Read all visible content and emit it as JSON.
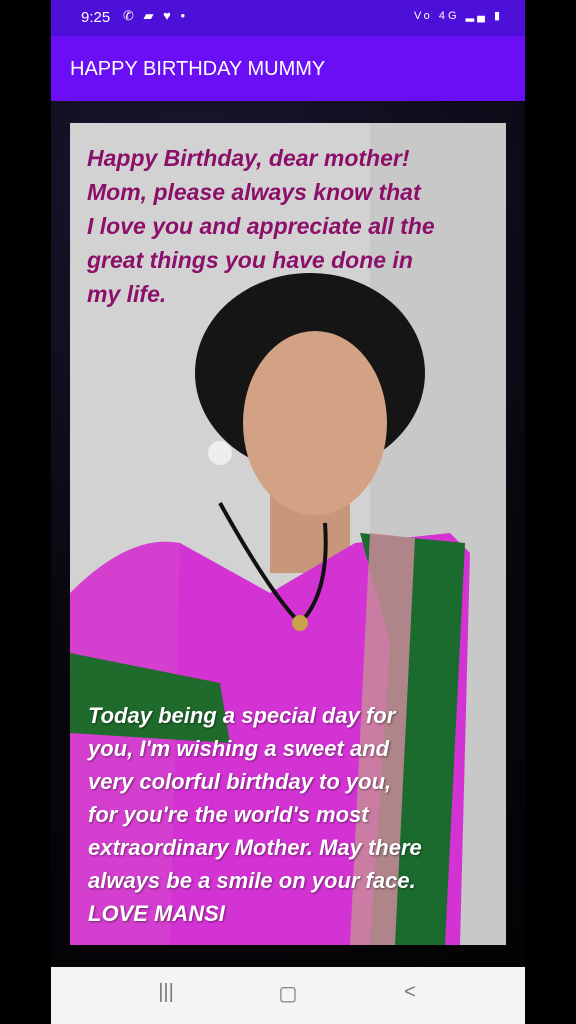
{
  "status_bar": {
    "time": "9:25",
    "left_icons": [
      "messenger-icon",
      "message-icon",
      "heart-icon",
      "dot-icon"
    ],
    "right_icons": [
      "volte-icon",
      "4g-icon",
      "signal-icon",
      "battery-icon"
    ],
    "network_label": "4G"
  },
  "app_bar": {
    "title": "HAPPY BIRTHDAY MUMMY",
    "color": "#6a0ef6"
  },
  "card": {
    "top_message": "Happy Birthday, dear mother!\nMom, please always know that\nI love you and appreciate all the\ngreat things you have done in\nmy life.",
    "bottom_message": "Today being a special day for\nyou, I'm wishing a sweet and\nvery colorful birthday to you,\nfor you're the world's most\nextraordinary Mother. May there\nalways be a smile on your face.\nLOVE MANSI",
    "top_text_color": "#8c0f6a",
    "bottom_text_color": "#ffffff"
  },
  "nav_bar": {
    "recents": "recents-icon",
    "home": "home-icon",
    "back": "back-icon"
  }
}
